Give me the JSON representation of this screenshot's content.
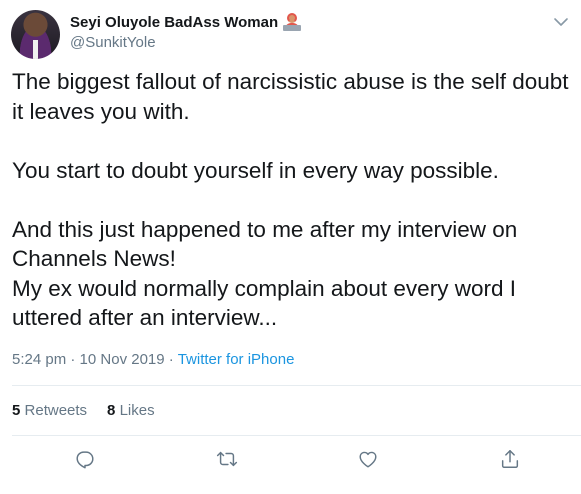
{
  "author": {
    "display_name": "Seyi Oluyole BadAss Woman",
    "handle": "@SunkitYole",
    "emoji": "woman-technologist-emoji"
  },
  "tweet": {
    "paragraph_1": [
      "The biggest fallout of narcissistic abuse is the self doubt",
      "it leaves you with."
    ],
    "paragraph_2": [
      "You start to doubt yourself in every way possible."
    ],
    "paragraph_3": [
      "And this just happened to me after my interview on",
      "Channels News!",
      "My ex would normally complain about every word I",
      "uttered after an interview..."
    ]
  },
  "meta": {
    "time": "5:24 pm",
    "separator_1": " · ",
    "date": "10 Nov 2019",
    "separator_2": " · ",
    "source": "Twitter for iPhone"
  },
  "stats": {
    "retweets_count": "5",
    "retweets_label": "Retweets",
    "likes_count": "8",
    "likes_label": "Likes"
  },
  "actions": {
    "reply_icon": "reply-icon",
    "retweet_icon": "retweet-icon",
    "like_icon": "heart-icon",
    "share_icon": "share-icon"
  },
  "colors": {
    "text": "#14171a",
    "muted": "#657786",
    "link": "#1b95e0",
    "divider": "#e6ecf0"
  }
}
